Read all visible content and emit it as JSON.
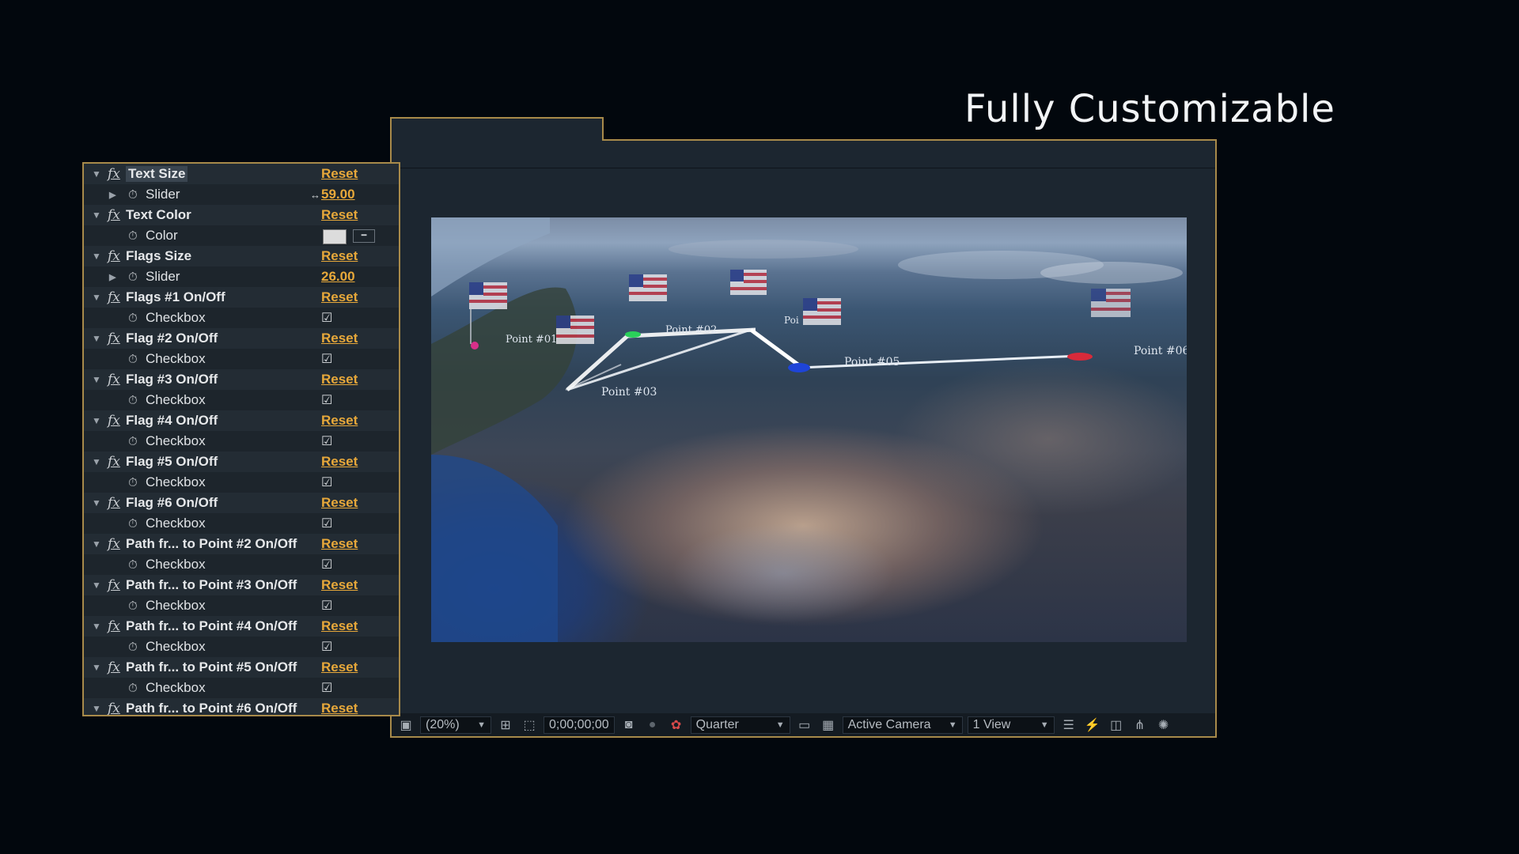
{
  "headline": "Fully Customizable",
  "effects": [
    {
      "kind": "effect",
      "label": "Text Size",
      "reset": "Reset",
      "highlight": true
    },
    {
      "kind": "slider",
      "label": "Slider",
      "value": "59.00"
    },
    {
      "kind": "effect",
      "label": "Text Color",
      "reset": "Reset"
    },
    {
      "kind": "color",
      "label": "Color",
      "swatch": "#dcdcdc"
    },
    {
      "kind": "effect",
      "label": "Flags Size",
      "reset": "Reset"
    },
    {
      "kind": "slider",
      "label": "Slider",
      "value": "26.00"
    },
    {
      "kind": "effect",
      "label": "Flags #1 On/Off",
      "reset": "Reset"
    },
    {
      "kind": "checkbox",
      "label": "Checkbox",
      "checked": true
    },
    {
      "kind": "effect",
      "label": "Flag #2 On/Off",
      "reset": "Reset"
    },
    {
      "kind": "checkbox",
      "label": "Checkbox",
      "checked": true
    },
    {
      "kind": "effect",
      "label": "Flag #3 On/Off",
      "reset": "Reset"
    },
    {
      "kind": "checkbox",
      "label": "Checkbox",
      "checked": true
    },
    {
      "kind": "effect",
      "label": "Flag #4 On/Off",
      "reset": "Reset"
    },
    {
      "kind": "checkbox",
      "label": "Checkbox",
      "checked": true
    },
    {
      "kind": "effect",
      "label": "Flag #5 On/Off",
      "reset": "Reset"
    },
    {
      "kind": "checkbox",
      "label": "Checkbox",
      "checked": true
    },
    {
      "kind": "effect",
      "label": "Flag #6 On/Off",
      "reset": "Reset"
    },
    {
      "kind": "checkbox",
      "label": "Checkbox",
      "checked": true
    },
    {
      "kind": "effect",
      "label": "Path fr... to Point #2 On/Off",
      "reset": "Reset"
    },
    {
      "kind": "checkbox",
      "label": "Checkbox",
      "checked": true
    },
    {
      "kind": "effect",
      "label": "Path fr... to Point #3 On/Off",
      "reset": "Reset"
    },
    {
      "kind": "checkbox",
      "label": "Checkbox",
      "checked": true
    },
    {
      "kind": "effect",
      "label": "Path fr... to Point #4 On/Off",
      "reset": "Reset"
    },
    {
      "kind": "checkbox",
      "label": "Checkbox",
      "checked": true
    },
    {
      "kind": "effect",
      "label": "Path fr... to Point #5 On/Off",
      "reset": "Reset"
    },
    {
      "kind": "checkbox",
      "label": "Checkbox",
      "checked": true
    },
    {
      "kind": "effect",
      "label": "Path fr... to Point #6 On/Off",
      "reset": "Reset"
    }
  ],
  "viewport": {
    "point_labels": [
      "Point #01",
      "Point #02",
      "Point #03",
      "Point #05",
      "Point #06",
      "Poi"
    ]
  },
  "toolbar": {
    "magnification": "(20%)",
    "timecode": "0;00;00;00",
    "resolution": "Quarter",
    "camera": "Active Camera",
    "views": "1 View"
  },
  "colors": {
    "accent": "#e7a83a",
    "border": "#a88a4a",
    "panel": "#1d252c"
  }
}
